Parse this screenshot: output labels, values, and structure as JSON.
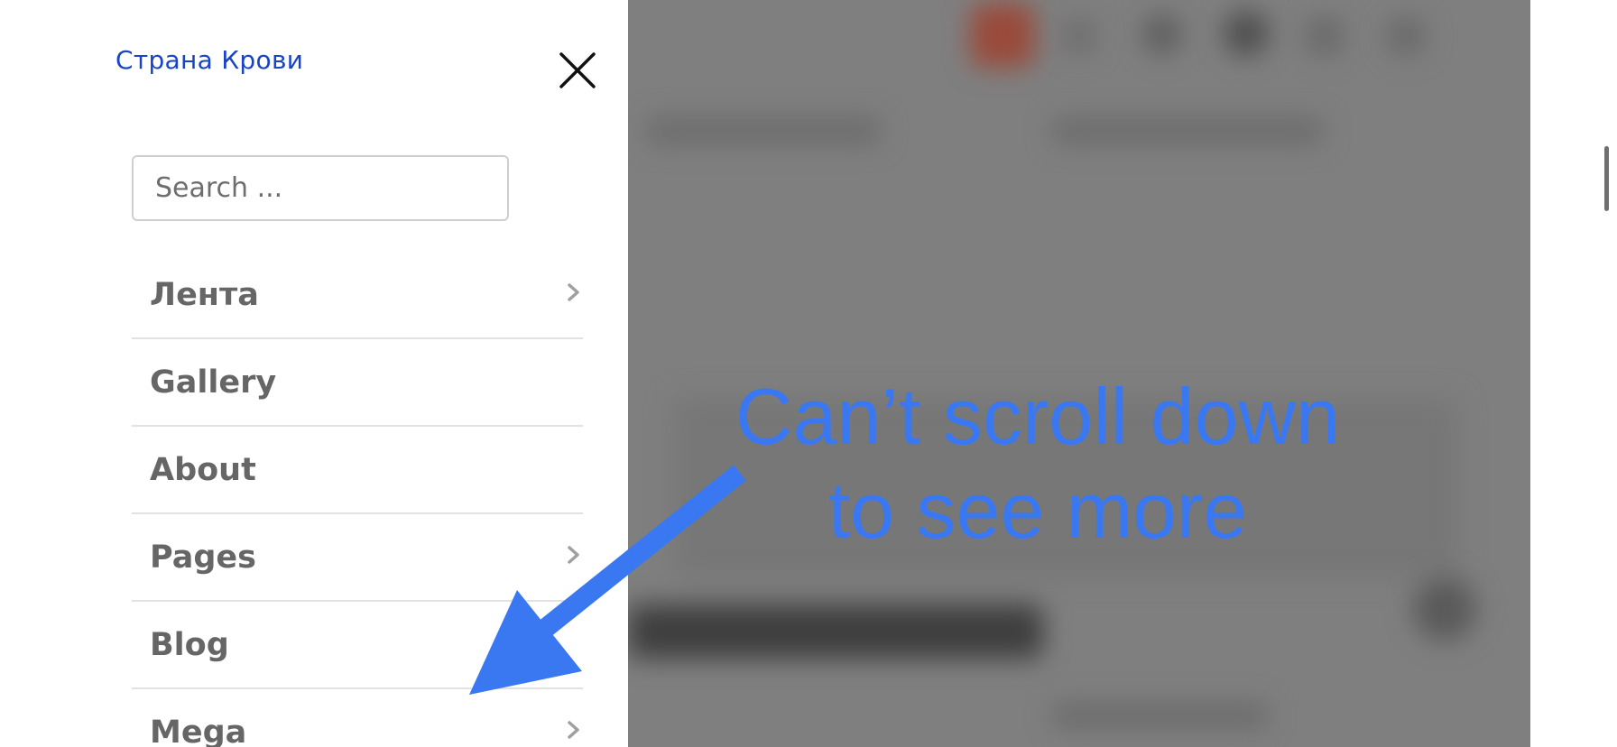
{
  "drawer": {
    "site_title": "Страна Крови",
    "close_icon": "close-icon",
    "search": {
      "placeholder": "Search ...",
      "value": ""
    },
    "menu_items": [
      {
        "label": "Лента",
        "has_submenu": true
      },
      {
        "label": "Gallery",
        "has_submenu": false
      },
      {
        "label": "About",
        "has_submenu": false
      },
      {
        "label": "Pages",
        "has_submenu": true
      },
      {
        "label": "Blog",
        "has_submenu": false
      },
      {
        "label": "Mega",
        "has_submenu": true
      }
    ]
  },
  "annotation": {
    "line1": "Can’t scroll down",
    "line2": "to see more",
    "color": "#3a78f2",
    "arrow_icon": "arrow-icon"
  },
  "colors": {
    "site_title": "#1a44c8",
    "menu_text": "#666666",
    "overlay": "#7f7f7f",
    "annotation": "#3a78f2"
  }
}
